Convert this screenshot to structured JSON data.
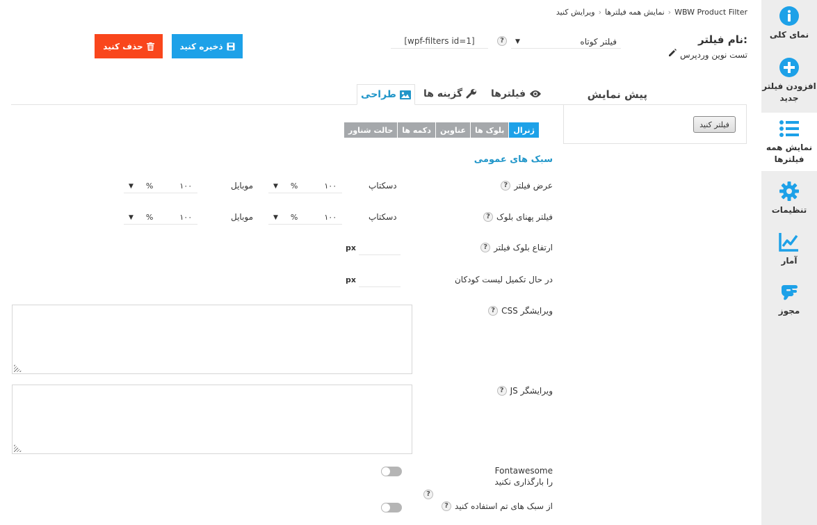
{
  "breadcrumb": {
    "items": [
      "WBW Product Filter",
      "نمایش همه فیلترها",
      "ویرایش کنید"
    ],
    "separator": "‹"
  },
  "sidebar": {
    "items": [
      {
        "label": "نمای کلی",
        "icon": "info-icon"
      },
      {
        "label": "افزودن فیلتر جدید",
        "icon": "plus-circle-icon"
      },
      {
        "label": "نمایش همه فیلترها",
        "icon": "list-icon"
      },
      {
        "label": "تنظیمات",
        "icon": "gear-icon"
      },
      {
        "label": "آمار",
        "icon": "chart-line-icon"
      },
      {
        "label": "مجوز",
        "icon": "hand-icon"
      }
    ],
    "accent": "#1da1e8"
  },
  "header": {
    "filter_name_label": "نام فیلتر:",
    "filter_name_value": "تست نوین وردپرس",
    "filter_type": "فیلتر کوتاه",
    "help": "?",
    "shortcode": "[wpf-filters id=1]",
    "save_label": "ذخیره کنید",
    "delete_label": "حذف کنید",
    "save_color": "#1da1e8",
    "delete_color": "#f9461c"
  },
  "preview": {
    "title": "پیش نمایش",
    "button_label": "فیلتر کنید"
  },
  "tabs": [
    {
      "label": "فیلترها",
      "icon": "eye-icon"
    },
    {
      "label": "گزینه ها",
      "icon": "wrench-icon"
    },
    {
      "label": "طراحی",
      "icon": "image-icon",
      "active": true
    }
  ],
  "subtabs": [
    "ژنرال",
    "بلوک ها",
    "عناوین",
    "دکمه ها",
    "حالت شناور"
  ],
  "form": {
    "section_title": "سبک های عمومی",
    "desktop_label": "دسکتاپ",
    "mobile_label": "موبایل",
    "percent": "%",
    "px": "px",
    "rows": [
      {
        "label": "عرض فیلتر",
        "desktop_value": "۱۰۰",
        "mobile_value": "۱۰۰"
      },
      {
        "label": "فیلتر پهنای بلوک",
        "desktop_value": "۱۰۰",
        "mobile_value": "۱۰۰"
      }
    ],
    "block_height_label": "ارتفاع بلوک فیلتر",
    "children_label": "در حال تکمیل لیست کودکان",
    "css_label": "ویرایشگر CSS",
    "js_label": "ویرایشگر JS",
    "fontawesome_label_1": "Fontawesome",
    "fontawesome_label_2": "را بارگذاری نکنید",
    "theme_styles_label": "از سبک های تم استفاده کنید"
  }
}
